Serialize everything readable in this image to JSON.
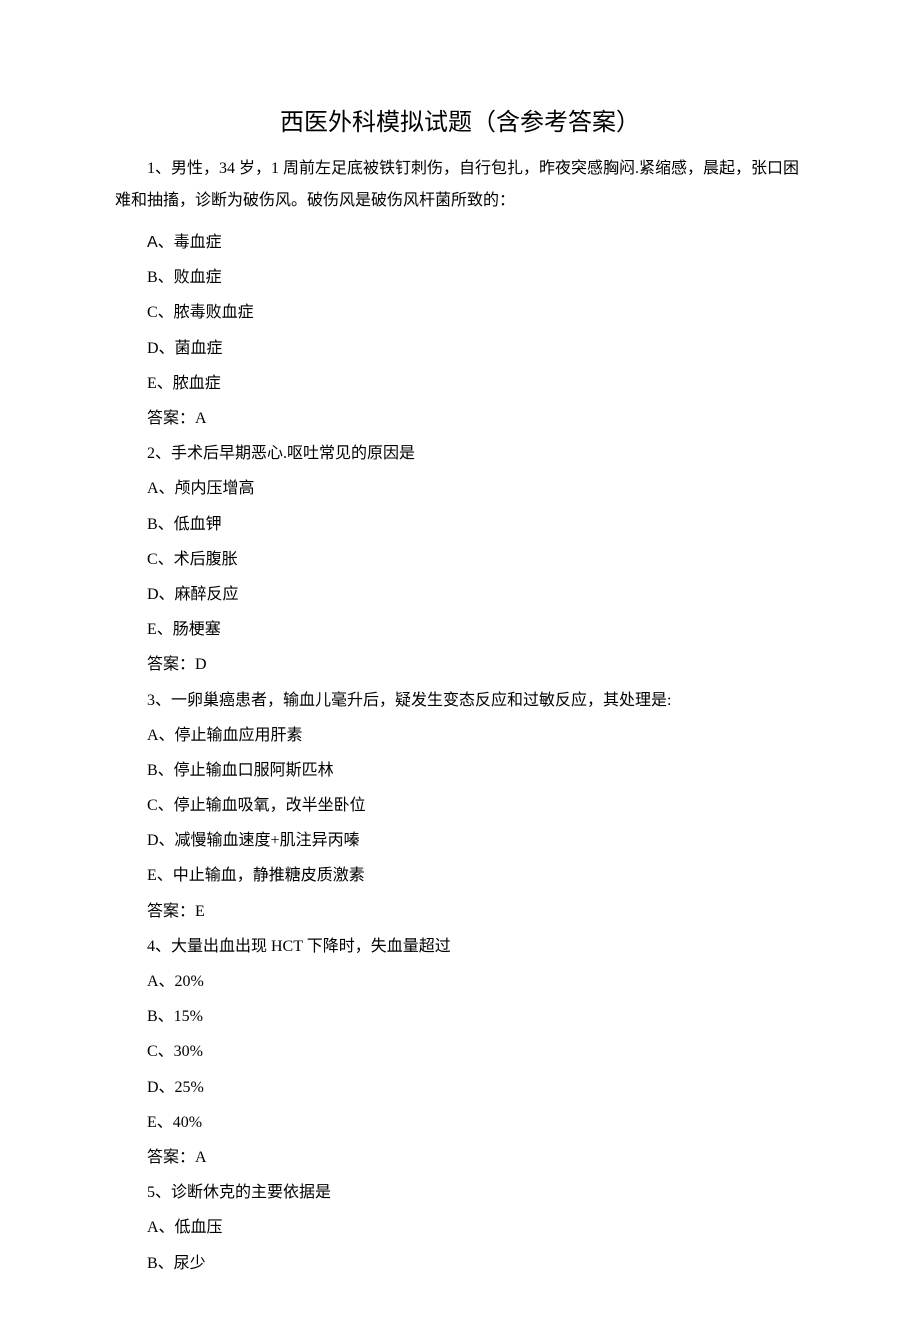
{
  "title": "西医外科模拟试题（含参考答案）",
  "intro": "1、男性，34 岁，1 周前左足底被铁钉刺伤，自行包扎，昨夜突感胸闷.紧缩感，晨起，张口困难和抽搐，诊断为破伤风。破伤风是破伤风杆菌所致的：",
  "lines": [
    {
      "text": "A、毒血症",
      "arialPrefix": true
    },
    {
      "text": "B、败血症"
    },
    {
      "text": "C、脓毒败血症"
    },
    {
      "text": "D、菌血症"
    },
    {
      "text": "E、脓血症"
    },
    {
      "text": "答案：A"
    },
    {
      "text": "2、手术后早期恶心.呕吐常见的原因是"
    },
    {
      "text": "A、颅内压增高"
    },
    {
      "text": "B、低血钾"
    },
    {
      "text": "C、术后腹胀"
    },
    {
      "text": "D、麻醉反应"
    },
    {
      "text": "E、肠梗塞"
    },
    {
      "text": "答案：D"
    },
    {
      "text": "3、一卵巢癌患者，输血儿毫升后，疑发生变态反应和过敏反应，其处理是:"
    },
    {
      "text": "A、停止输血应用肝素"
    },
    {
      "text": "B、停止输血口服阿斯匹林"
    },
    {
      "text": "C、停止输血吸氧，改半坐卧位"
    },
    {
      "text": "D、减慢输血速度+肌注异丙嗪"
    },
    {
      "text": "E、中止输血，静推糖皮质激素"
    },
    {
      "text": "答案：E"
    },
    {
      "text": "4、大量出血出现 HCT 下降时，失血量超过"
    },
    {
      "text": "A、20%"
    },
    {
      "text": "B、15%"
    },
    {
      "text": "C、30%"
    },
    {
      "text": "D、25%"
    },
    {
      "text": "E、40%"
    },
    {
      "text": "答案：A"
    },
    {
      "text": "5、诊断休克的主要依据是"
    },
    {
      "text": "A、低血压"
    },
    {
      "text": "B、尿少"
    }
  ]
}
